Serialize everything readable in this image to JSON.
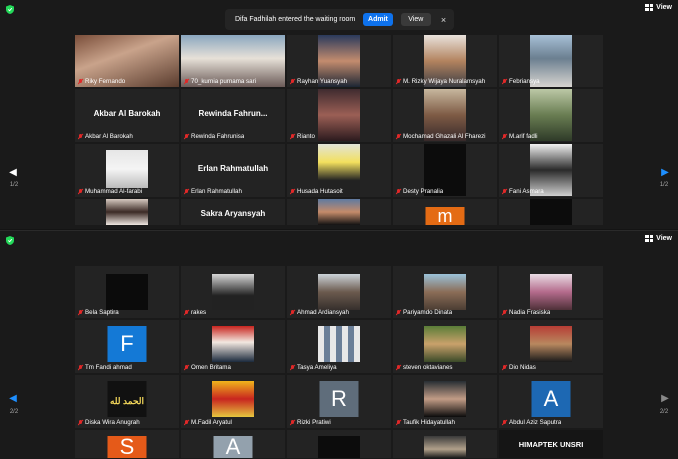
{
  "notification": {
    "message": "Difa Fadhilah entered the waiting room",
    "admit_label": "Admit",
    "view_label": "View",
    "close_symbol": "×"
  },
  "view_label": "View",
  "top": {
    "page_label": "1/2",
    "tiles": [
      {
        "name": "Riky Fernando"
      },
      {
        "name": "70_kurnia purnama sari"
      },
      {
        "name": "Rayhan Yuansyah"
      },
      {
        "name": "M. Rizky Wijaya Nuralamsyah"
      },
      {
        "name": "Febriansya"
      },
      {
        "name": "Akbar Al Barokah",
        "label": "Akbar Al Barokah"
      },
      {
        "name": "Rewinda Fahrunisa",
        "label": "Rewinda Fahrun..."
      },
      {
        "name": "Rianto"
      },
      {
        "name": "Mochamad Ghazali Al Fharezi"
      },
      {
        "name": "M.arif fadli"
      },
      {
        "name": "Muhammad Al-farabi"
      },
      {
        "name": "Erlan Rahmatullah",
        "label": "Erlan Rahmatullah"
      },
      {
        "name": "Husada Hutasoit"
      },
      {
        "name": "Desty Pranalia"
      },
      {
        "name": "Fani Asmara"
      },
      {
        "name": ""
      },
      {
        "name": "",
        "label": "Sakra Aryansyah"
      },
      {
        "name": ""
      },
      {
        "name": "",
        "initial": "m"
      },
      {
        "name": ""
      }
    ]
  },
  "bottom": {
    "page_label": "2/2",
    "tiles": [
      {
        "name": "Bela Saptira"
      },
      {
        "name": "rakes"
      },
      {
        "name": "Ahmad Ardiansyah"
      },
      {
        "name": "Pariyamdo Dinata"
      },
      {
        "name": "Nadia Frasiska"
      },
      {
        "name": "Tm Fandi ahmad",
        "initial": "F"
      },
      {
        "name": "Omen Britama"
      },
      {
        "name": "Tasya Ameliya"
      },
      {
        "name": "steven oktavianes"
      },
      {
        "name": "Dio Nidas"
      },
      {
        "name": "Diska Wira Anugrah",
        "logo": "الحمد لله"
      },
      {
        "name": "M.Fadil Aryatul"
      },
      {
        "name": "Rizki Pratiwi",
        "initial": "R"
      },
      {
        "name": "Taufik Hidayatullah"
      },
      {
        "name": "Abdul Aziz Saputra",
        "initial": "A"
      },
      {
        "name": "",
        "initial": "S"
      },
      {
        "name": "",
        "initial": "A"
      },
      {
        "name": ""
      },
      {
        "name": ""
      },
      {
        "name": "",
        "label": "HIMAPTEK UNSRI"
      }
    ]
  },
  "colors": {
    "admit_blue": "#0e72ed",
    "speaker_highlight": "#c9d12e",
    "muted_red": "#e02828",
    "shield_green": "#23d959"
  }
}
